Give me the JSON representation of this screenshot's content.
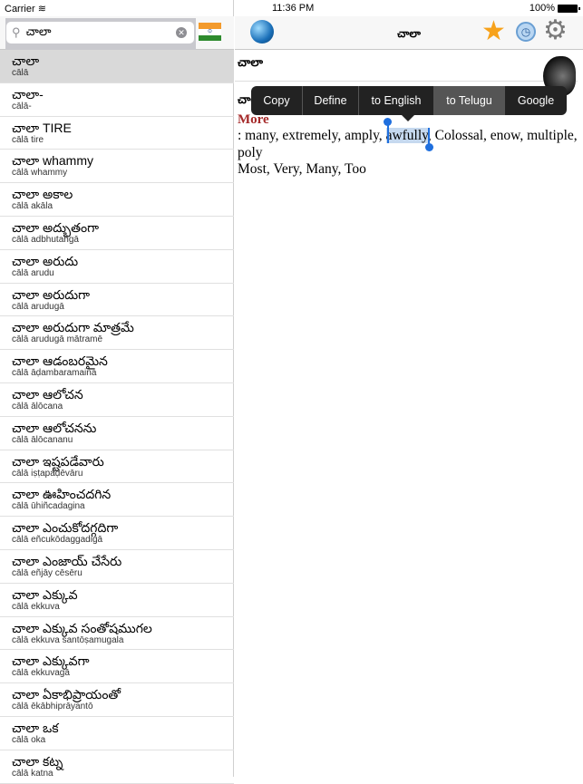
{
  "status": {
    "carrier": "Carrier",
    "time": "11:36 PM",
    "battery": "100%"
  },
  "search": {
    "value": "చాలా",
    "placeholder": ""
  },
  "nav": {
    "title": "చాలా"
  },
  "list": [
    {
      "te": "చాలా",
      "tr": "cālā"
    },
    {
      "te": "చాలా-",
      "tr": "cālā-"
    },
    {
      "te": "చాలా TIRE",
      "tr": "cālā tire"
    },
    {
      "te": "చాలా whammy",
      "tr": "cālā whammy"
    },
    {
      "te": "చాలా అకాల",
      "tr": "cālā akāla"
    },
    {
      "te": "చాలా అద్భుతంగా",
      "tr": "cālā adbhutaṅgā"
    },
    {
      "te": "చాలా అరుదు",
      "tr": "cālā arudu"
    },
    {
      "te": "చాలా అరుదుగా",
      "tr": "cālā arudugā"
    },
    {
      "te": "చాలా అరుదుగా మాత్రమే",
      "tr": "cālā arudugā mātramē"
    },
    {
      "te": "చాలా ఆడంబరమైన",
      "tr": "cālā āḍambaramaina"
    },
    {
      "te": "చాలా ఆలోచన",
      "tr": "cālā ālōcana"
    },
    {
      "te": "చాలా ఆలోచనను",
      "tr": "cālā ālōcananu"
    },
    {
      "te": "చాలా ఇష్టపడేవారు",
      "tr": "cālā iṣṭapaḍēvāru"
    },
    {
      "te": "చాలా ఊహించదగిన",
      "tr": "cālā ūhiñcadagina"
    },
    {
      "te": "చాలా ఎంచుకోదగ్గదిగా",
      "tr": "cālā eñcukōdaggadigā"
    },
    {
      "te": "చాలా ఎంజాయ్ చేసేరు",
      "tr": "cālā eñjāy cēsēru"
    },
    {
      "te": "చాలా ఎక్కువ",
      "tr": "cālā ekkuva"
    },
    {
      "te": "చాలా ఎక్కువ సంతోషముగల",
      "tr": "cālā ekkuva santōṣamugala"
    },
    {
      "te": "చాలా ఎక్కువగా",
      "tr": "cālā ekkuvagā"
    },
    {
      "te": "చాలా ఏకాభిప్రాయంతో",
      "tr": "cālā ēkābhiprāyantō"
    },
    {
      "te": "చాలా ఒక",
      "tr": "cālā oka"
    },
    {
      "te": "చాలా కట్న",
      "tr": "cālā katna"
    }
  ],
  "detail": {
    "headword": "చాలా",
    "headword2": "చాలా",
    "more": "More",
    "def_before": ": many, extremely, amply, ",
    "def_selected": "awfully",
    "def_after": ", Colossal, enow, multiple, poly",
    "line2": "Most, Very, Many, Too"
  },
  "menu": {
    "items": [
      "Copy",
      "Define",
      "to English",
      "to Telugu",
      "Google"
    ],
    "active": "to Telugu"
  },
  "colors": {
    "selection": "#c6d9ef",
    "more": "#a52a2a",
    "menu_bg": "#222222"
  }
}
